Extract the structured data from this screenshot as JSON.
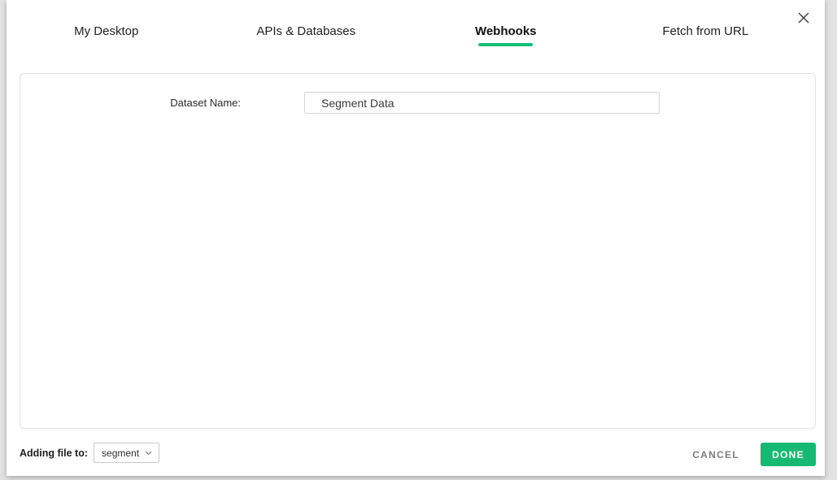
{
  "modal": {
    "close_icon": "close",
    "tabs": [
      {
        "label": "My Desktop",
        "active": false
      },
      {
        "label": "APIs & Databases",
        "active": false
      },
      {
        "label": "Webhooks",
        "active": true
      },
      {
        "label": "Fetch from URL",
        "active": false
      }
    ],
    "form": {
      "dataset_name_label": "Dataset Name:",
      "dataset_name_value": "Segment Data"
    },
    "footer": {
      "adding_file_label": "Adding file to:",
      "folder_select_value": "segment",
      "chevron_icon": "chevron-down",
      "cancel_label": "CANCEL",
      "done_label": "DONE"
    },
    "colors": {
      "accent_green": "#15b971",
      "tab_underline_green": "#15bd77",
      "cancel_gray": "#7d7d7d",
      "panel_border": "#e3e3e3"
    }
  }
}
